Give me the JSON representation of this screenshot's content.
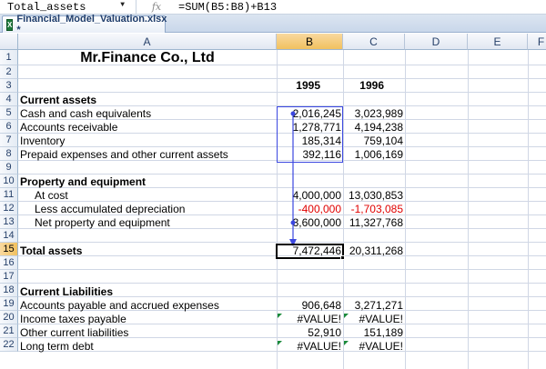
{
  "formula_bar": {
    "name_box": "Total_assets",
    "fx_symbol": "fx",
    "formula": "=SUM(B5:B8)+B13"
  },
  "tab": {
    "icon": "excel-workbook-icon",
    "title": "Financial_Model_Valuation.xlsx *"
  },
  "columns": [
    "A",
    "B",
    "C",
    "D",
    "E",
    "F"
  ],
  "rows": [
    "1",
    "2",
    "3",
    "4",
    "5",
    "6",
    "7",
    "8",
    "9",
    "10",
    "11",
    "12",
    "13",
    "14",
    "15",
    "16",
    "17",
    "18",
    "19",
    "20",
    "21",
    "22"
  ],
  "sheet": {
    "title": "Mr.Finance Co., Ltd",
    "year1": "1995",
    "year2": "1996",
    "current_assets_header": "Current assets",
    "r5": {
      "label": "Cash and cash equivalents",
      "b": "2,016,245",
      "c": "3,023,989"
    },
    "r6": {
      "label": "Accounts receivable",
      "b": "1,278,771",
      "c": "4,194,238"
    },
    "r7": {
      "label": "Inventory",
      "b": "185,314",
      "c": "759,104"
    },
    "r8": {
      "label": "Prepaid expenses and other current assets",
      "b": "392,116",
      "c": "1,006,169"
    },
    "ppe_header": "Property and equipment",
    "r11": {
      "label": "At cost",
      "b": "4,000,000",
      "c": "13,030,853"
    },
    "r12": {
      "label": "Less accumulated depreciation",
      "b": "-400,000",
      "c": "-1,703,085"
    },
    "r13": {
      "label": "Net property and equipment",
      "b": "3,600,000",
      "c": "11,327,768"
    },
    "r15": {
      "label": "Total assets",
      "b": "7,472,446",
      "c": "20,311,268"
    },
    "liab_header": "Current Liabilities",
    "r19": {
      "label": "Accounts payable and accrued expenses",
      "b": "906,648",
      "c": "3,271,271"
    },
    "r20": {
      "label": "Income taxes payable",
      "b": "#VALUE!",
      "c": "#VALUE!"
    },
    "r21": {
      "label": "Other current liabilities",
      "b": "52,910",
      "c": "151,189"
    },
    "r22": {
      "label": "Long term debt",
      "b": "#VALUE!",
      "c": "#VALUE!"
    }
  },
  "colors": {
    "trace_arrow": "#3b47e0",
    "negative": "#e00000",
    "selected_header": "#f1c15f"
  }
}
